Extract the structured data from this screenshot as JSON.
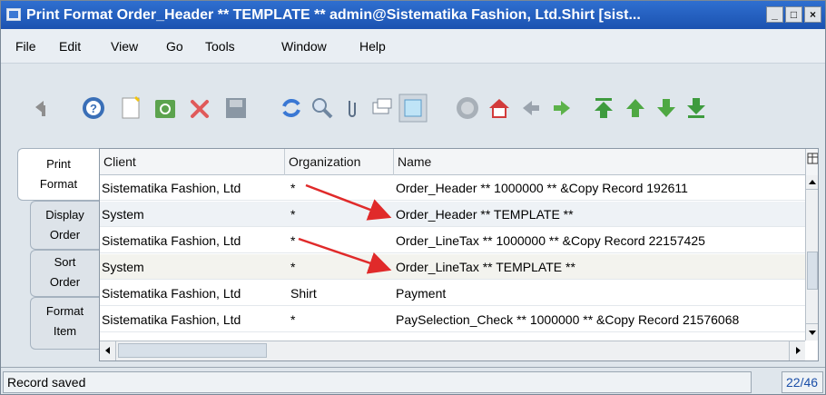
{
  "window": {
    "title": "Print Format  Order_Header  ** TEMPLATE **  admin@Sistematika Fashion, Ltd.Shirt [sist...",
    "buttons": [
      "_",
      "□",
      "×"
    ]
  },
  "menu": [
    "File",
    "Edit",
    "View",
    "Go",
    "Tools",
    "Window",
    "Help"
  ],
  "toolbar": {
    "icons": [
      "undo-icon",
      "help-icon",
      "new-icon",
      "copy-record-icon",
      "delete-icon",
      "save-icon",
      "refresh-icon",
      "find-icon",
      "attachment-icon",
      "chat-icon",
      "grid-toggle-icon",
      "history-icon",
      "home-icon",
      "previous-icon",
      "next-icon",
      "first-record-icon",
      "record-up-icon",
      "record-down-icon",
      "last-record-icon"
    ]
  },
  "tabs": [
    "Print Format",
    "Display Order",
    "Sort Order",
    "Format Item"
  ],
  "grid": {
    "columns": [
      "Client",
      "Organization",
      "Name"
    ],
    "rows": [
      {
        "client": "Sistematika Fashion, Ltd",
        "org": "*",
        "name": "Order_Header  ** 1000000 ** &Copy Record 192611"
      },
      {
        "client": "System",
        "org": "*",
        "name": "Order_Header  ** TEMPLATE **"
      },
      {
        "client": "Sistematika Fashion, Ltd",
        "org": "*",
        "name": "Order_LineTax  ** 1000000 ** &Copy Record 22157425"
      },
      {
        "client": "System",
        "org": "*",
        "name": "Order_LineTax  ** TEMPLATE **"
      },
      {
        "client": "Sistematika Fashion, Ltd",
        "org": "Shirt",
        "name": "Payment"
      },
      {
        "client": "Sistematika Fashion, Ltd",
        "org": "*",
        "name": "PaySelection_Check  ** 1000000 ** &Copy Record 21576068"
      }
    ]
  },
  "status": {
    "message": "Record saved",
    "counter": "22/46"
  },
  "colors": {
    "titlebar": "#1b52b0",
    "arrow": "#e02a2a"
  }
}
